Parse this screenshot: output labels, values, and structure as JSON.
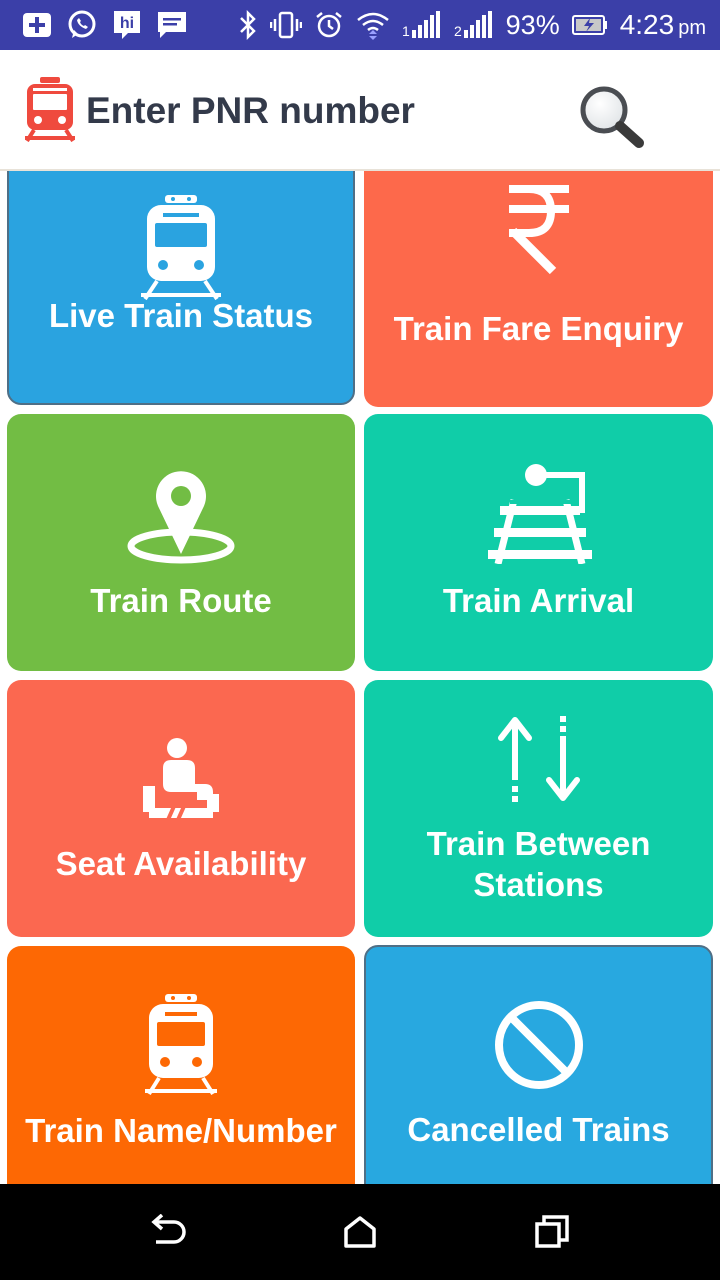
{
  "status_bar": {
    "battery": "93%",
    "time": "4:23",
    "ampm": "pm",
    "icons": [
      "add-icon",
      "whatsapp-icon",
      "hike-icon",
      "message-icon",
      "bluetooth-icon",
      "vibrate-icon",
      "alarm-icon",
      "wifi-icon",
      "signal-1-icon",
      "signal-2-icon",
      "battery-charging-icon"
    ]
  },
  "app_bar": {
    "title": "Enter PNR number",
    "logo_icon": "train-icon",
    "search_icon": "search-icon"
  },
  "tiles": [
    {
      "label": "Live Train Status",
      "icon": "train-front-icon",
      "color": "#2aa3e0"
    },
    {
      "label": "Train Fare Enquiry",
      "icon": "rupee-icon",
      "color": "#fd694b"
    },
    {
      "label": "Train Route",
      "icon": "location-pin-icon",
      "color": "#72bd44"
    },
    {
      "label": "Train Arrival",
      "icon": "railway-track-icon",
      "color": "#10cda8"
    },
    {
      "label": "Seat Availability",
      "icon": "seated-person-icon",
      "color": "#fb6850"
    },
    {
      "label": "Train Between",
      "label2": "Stations",
      "icon": "up-down-arrows-icon",
      "color": "#10cda8"
    },
    {
      "label": "Train Name/Number",
      "icon": "train-front-icon",
      "color": "#fd6804"
    },
    {
      "label": "Cancelled Trains",
      "icon": "cancel-icon",
      "color": "#28a8e0"
    }
  ],
  "nav_bar": {
    "back_icon": "back-icon",
    "home_icon": "home-icon",
    "recents_icon": "recents-icon"
  },
  "colors": {
    "status_bar": "#3b3fa8",
    "title_text": "#333a4a",
    "logo_red": "#ef4a3e"
  }
}
